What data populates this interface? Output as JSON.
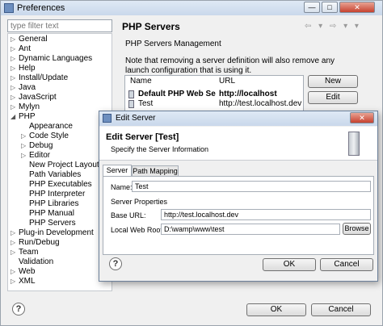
{
  "preferences": {
    "title": "Preferences",
    "filter_placeholder": "type filter text",
    "tree": [
      {
        "label": "General",
        "arrow": "▷"
      },
      {
        "label": "Ant",
        "arrow": "▷"
      },
      {
        "label": "Dynamic Languages",
        "arrow": "▷"
      },
      {
        "label": "Help",
        "arrow": "▷"
      },
      {
        "label": "Install/Update",
        "arrow": "▷"
      },
      {
        "label": "Java",
        "arrow": "▷"
      },
      {
        "label": "JavaScript",
        "arrow": "▷"
      },
      {
        "label": "Mylyn",
        "arrow": "▷"
      },
      {
        "label": "PHP",
        "arrow": "◢"
      },
      {
        "label": "Appearance",
        "arrow": ""
      },
      {
        "label": "Code Style",
        "arrow": "▷"
      },
      {
        "label": "Debug",
        "arrow": "▷"
      },
      {
        "label": "Editor",
        "arrow": "▷"
      },
      {
        "label": "New Project Layout",
        "arrow": ""
      },
      {
        "label": "Path Variables",
        "arrow": ""
      },
      {
        "label": "PHP Executables",
        "arrow": ""
      },
      {
        "label": "PHP Interpreter",
        "arrow": ""
      },
      {
        "label": "PHP Libraries",
        "arrow": ""
      },
      {
        "label": "PHP Manual",
        "arrow": ""
      },
      {
        "label": "PHP Servers",
        "arrow": ""
      },
      {
        "label": "Plug-in Development",
        "arrow": "▷"
      },
      {
        "label": "Run/Debug",
        "arrow": "▷"
      },
      {
        "label": "Team",
        "arrow": "▷"
      },
      {
        "label": "Validation",
        "arrow": ""
      },
      {
        "label": "Web",
        "arrow": "▷"
      },
      {
        "label": "XML",
        "arrow": "▷"
      }
    ],
    "panel": {
      "title": "PHP Servers",
      "subtitle": "PHP Servers Management",
      "note": "Note that removing a server definition will also remove any launch configuration that is using it.",
      "table": {
        "columns": [
          "Name",
          "URL"
        ],
        "rows": [
          {
            "name": "Default PHP Web Serv...",
            "url": "http://localhost"
          },
          {
            "name": "Test",
            "url": "http://test.localhost.dev"
          }
        ]
      },
      "buttons": {
        "new": "New",
        "edit": "Edit"
      }
    },
    "ok": "OK",
    "cancel": "Cancel"
  },
  "dialog": {
    "title": "Edit Server",
    "header_title": "Edit Server [Test]",
    "header_sub": "Specify the Server Information",
    "tabs": [
      "Server",
      "Path Mapping"
    ],
    "name_label": "Name:",
    "name_value": "Test",
    "properties_label": "Server Properties",
    "base_url_label": "Base URL:",
    "base_url_value": "http://test.localhost.dev",
    "web_root_label": "Local Web Root:",
    "web_root_value": "D:\\wamp\\www\\test",
    "browse": "Browse",
    "ok": "OK",
    "cancel": "Cancel"
  }
}
